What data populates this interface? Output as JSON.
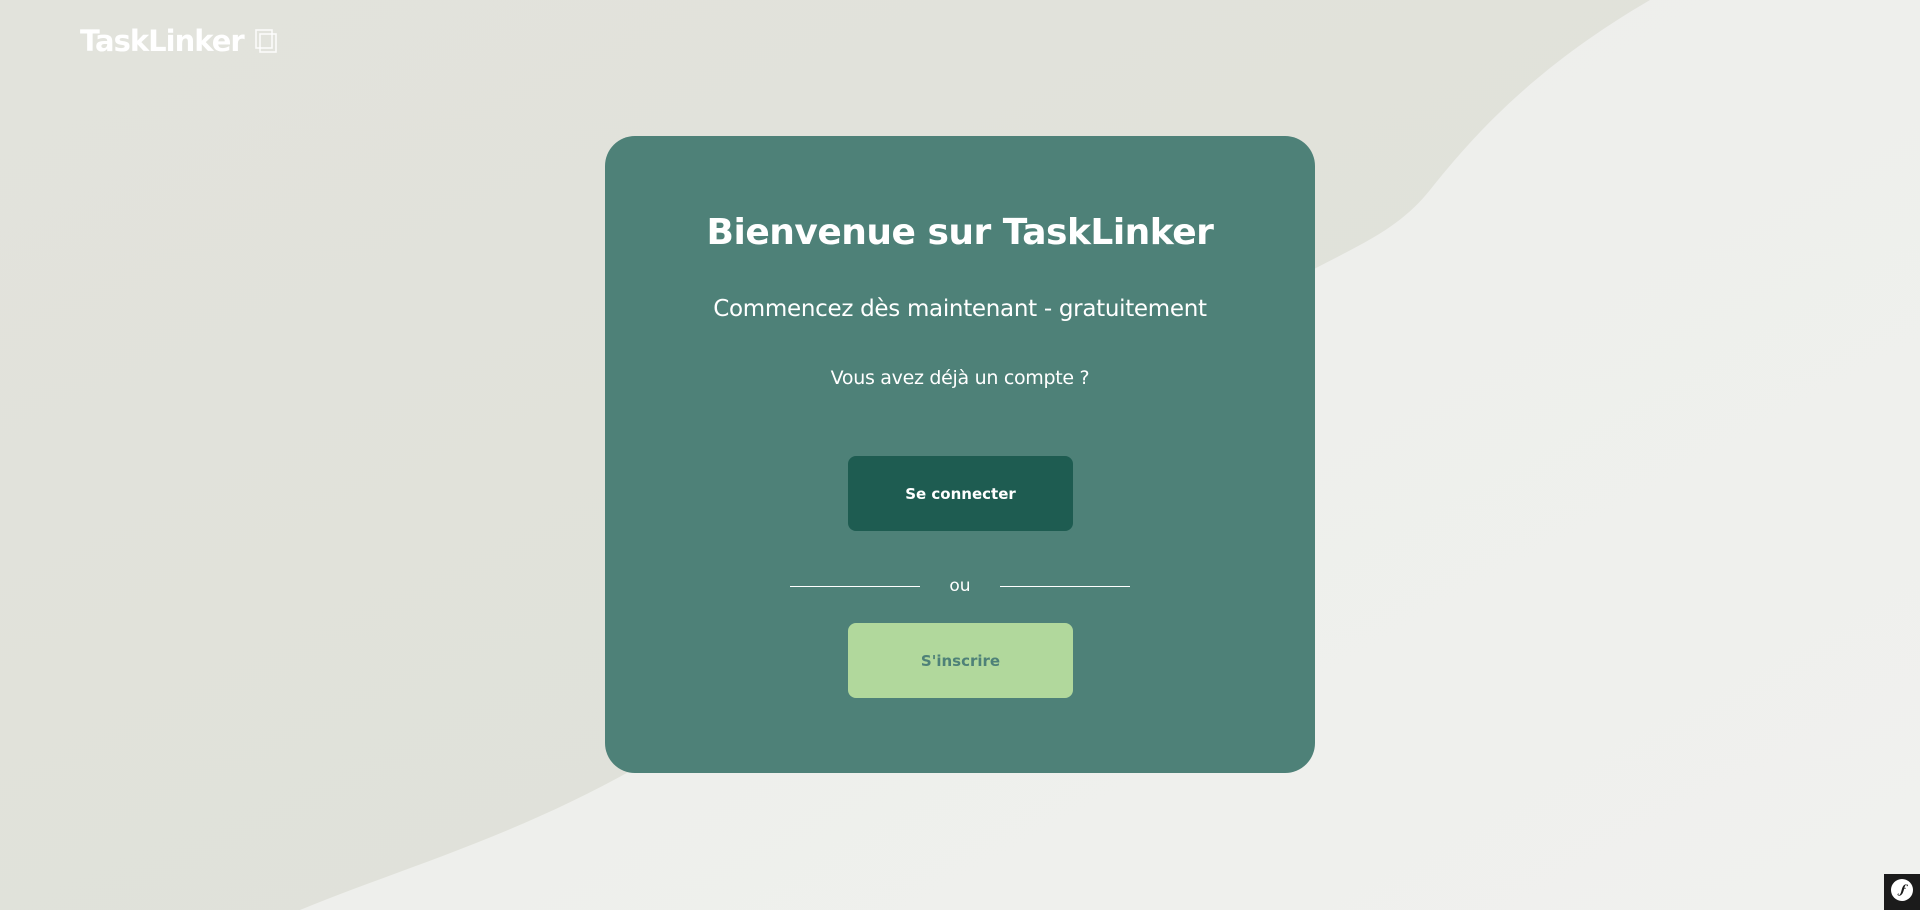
{
  "brand": {
    "name": "TaskLinker",
    "logo_icon": "stacked-squares-icon"
  },
  "card": {
    "title": "Bienvenue sur TaskLinker",
    "subtitle": "Commencez dès maintenant - gratuitement",
    "account_question": "Vous avez déjà un compte ?",
    "login_label": "Se connecter",
    "divider_label": "ou",
    "signup_label": "S'inscrire"
  },
  "colors": {
    "card_bg": "#4e8178",
    "login_bg": "#1e5c51",
    "signup_bg": "#b1d89c",
    "page_bg": "#e6e7e1"
  },
  "debug_toolbar": {
    "icon": "symfony-icon"
  }
}
